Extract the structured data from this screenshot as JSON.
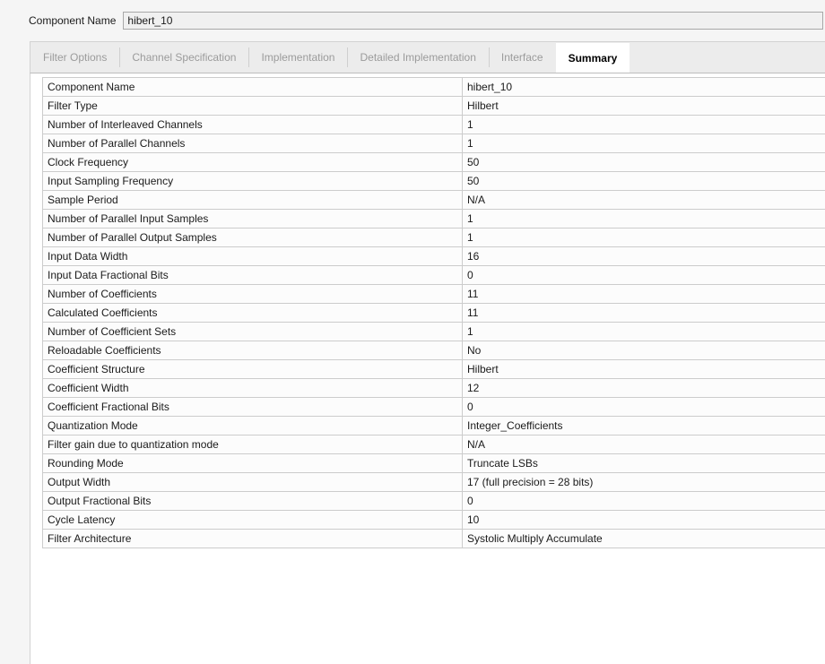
{
  "header": {
    "component_name_label": "Component Name",
    "component_name_value": "hibert_10",
    "component_name_placeholder": "Component Name"
  },
  "tabs": [
    {
      "label": "Filter Options",
      "active": false
    },
    {
      "label": "Channel Specification",
      "active": false
    },
    {
      "label": "Implementation",
      "active": false
    },
    {
      "label": "Detailed Implementation",
      "active": false
    },
    {
      "label": "Interface",
      "active": false
    },
    {
      "label": "Summary",
      "active": true
    }
  ],
  "summary": {
    "rows": [
      {
        "key": "Component Name",
        "value": "hibert_10"
      },
      {
        "key": "Filter Type",
        "value": "Hilbert"
      },
      {
        "key": "Number of Interleaved Channels",
        "value": "1"
      },
      {
        "key": "Number of Parallel Channels",
        "value": "1"
      },
      {
        "key": "Clock Frequency",
        "value": "50"
      },
      {
        "key": "Input Sampling Frequency",
        "value": "50"
      },
      {
        "key": "Sample Period",
        "value": "N/A"
      },
      {
        "key": "Number of Parallel Input Samples",
        "value": "1"
      },
      {
        "key": "Number of Parallel Output Samples",
        "value": "1"
      },
      {
        "key": "Input Data Width",
        "value": "16"
      },
      {
        "key": "Input Data Fractional Bits",
        "value": "0"
      },
      {
        "key": "Number of Coefficients",
        "value": "11"
      },
      {
        "key": "Calculated Coefficients",
        "value": "11"
      },
      {
        "key": "Number of Coefficient Sets",
        "value": "1"
      },
      {
        "key": "Reloadable Coefficients",
        "value": "No"
      },
      {
        "key": "Coefficient Structure",
        "value": "Hilbert"
      },
      {
        "key": "Coefficient Width",
        "value": "12"
      },
      {
        "key": "Coefficient Fractional Bits",
        "value": "0"
      },
      {
        "key": "Quantization Mode",
        "value": "Integer_Coefficients"
      },
      {
        "key": "Filter gain due to quantization mode",
        "value": "N/A"
      },
      {
        "key": "Rounding Mode",
        "value": "Truncate LSBs"
      },
      {
        "key": "Output Width",
        "value": "17 (full precision = 28 bits)"
      },
      {
        "key": "Output Fractional Bits",
        "value": "0"
      },
      {
        "key": "Cycle Latency",
        "value": "10"
      },
      {
        "key": "Filter Architecture",
        "value": "Systolic Multiply Accumulate"
      }
    ]
  },
  "colors": {
    "page_background": "#f5f5f5",
    "tabstrip_background": "#ececec",
    "panel_background": "#ffffff",
    "table_row_background": "#fcfcfc",
    "table_border": "#cccccc",
    "inactive_tab_text": "#9b9b9b",
    "active_tab_text": "#000000",
    "input_background": "#f0f0f0",
    "input_border": "#a8a8a8"
  }
}
